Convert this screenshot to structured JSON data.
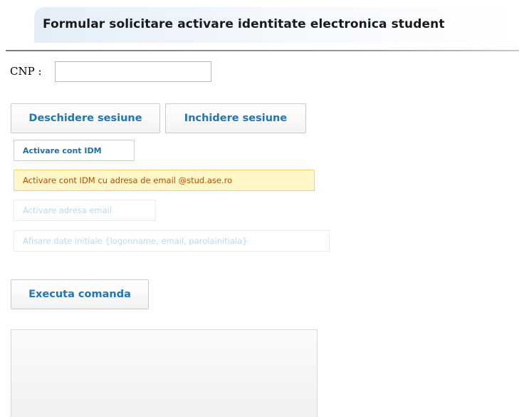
{
  "header": {
    "title": "Formular solicitare activare identitate electronica student"
  },
  "form": {
    "cnp_label": "CNP :",
    "cnp_value": "",
    "cnp_placeholder": ""
  },
  "session": {
    "open_label": "Deschidere sesiune",
    "close_label": "Inchidere sesiune"
  },
  "options": [
    {
      "label": "Activare cont IDM",
      "state": "enabled"
    },
    {
      "label": "Activare cont IDM cu adresa de email @stud.ase.ro",
      "state": "selected"
    },
    {
      "label": "Activare adresa email",
      "state": "disabled"
    },
    {
      "label": "Afisare date initiale {logonname, email, parolainitiala}",
      "state": "disabled"
    }
  ],
  "actions": {
    "execute_label": "Executa comanda"
  },
  "colors": {
    "link_blue": "#1f77b4",
    "selected_bg": "#fff7c7",
    "selected_border": "#f2d26a",
    "selected_text": "#b84e00",
    "disabled_text": "#bcd9ee"
  }
}
